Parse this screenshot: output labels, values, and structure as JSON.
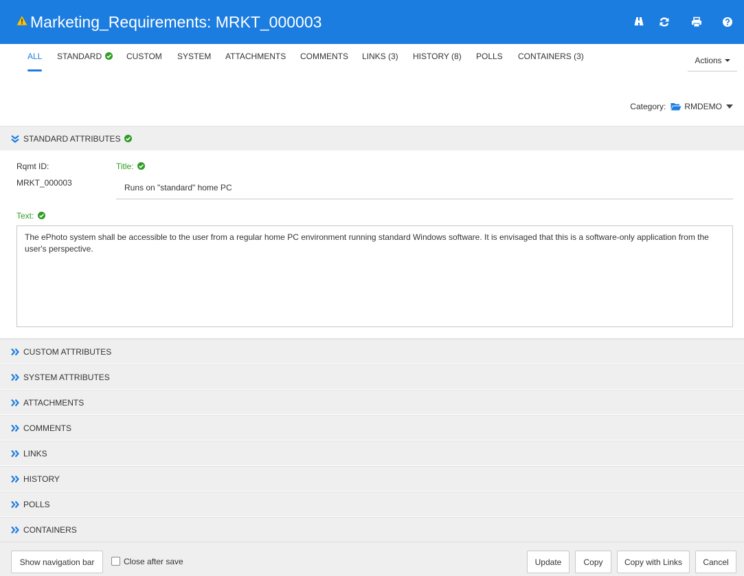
{
  "header": {
    "title": "Marketing_Requirements: MRKT_000003",
    "colors": {
      "background": "#1c7de0",
      "text": "#ffffff",
      "warning": "#f5c518"
    },
    "icons": [
      "warning-icon",
      "binoculars-icon",
      "refresh-icon",
      "print-icon",
      "help-icon"
    ]
  },
  "tabs": [
    {
      "label": "ALL"
    },
    {
      "label": "STANDARD"
    },
    {
      "label": "CUSTOM"
    },
    {
      "label": "SYSTEM"
    },
    {
      "label": "ATTACHMENTS"
    },
    {
      "label": "COMMENTS"
    },
    {
      "label": "LINKS (3)"
    },
    {
      "label": "HISTORY (8)"
    },
    {
      "label": "POLLS"
    },
    {
      "label": "CONTAINERS (3)"
    }
  ],
  "active_tab": "ALL",
  "actions_label": "Actions",
  "category": {
    "label": "Category:",
    "value": "RMDEMO"
  },
  "standard": {
    "header": "STANDARD ATTRIBUTES",
    "rqmt_id_label": "Rqmt ID:",
    "rqmt_id_value": "MRKT_000003",
    "title_label": "Title:",
    "title_value": "Runs on \"standard\" home PC",
    "text_label": "Text:",
    "text_value": "The ePhoto system shall be accessible to the user from a regular home PC environment running standard Windows software. It is envisaged that this is a software-only application from the user's perspective."
  },
  "sections": [
    {
      "label": "CUSTOM ATTRIBUTES"
    },
    {
      "label": "SYSTEM ATTRIBUTES"
    },
    {
      "label": "ATTACHMENTS"
    },
    {
      "label": "COMMENTS"
    },
    {
      "label": "LINKS"
    },
    {
      "label": "HISTORY"
    },
    {
      "label": "POLLS"
    },
    {
      "label": "CONTAINERS"
    }
  ],
  "footer": {
    "show_nav": "Show navigation bar",
    "close_after_save": "Close after save",
    "close_after_save_checked": false,
    "update": "Update",
    "copy": "Copy",
    "copy_with_links": "Copy with Links",
    "cancel": "Cancel"
  },
  "colors": {
    "accent": "#1c7de0",
    "ok_green": "#2e9c26",
    "section_bg": "#efefef"
  }
}
